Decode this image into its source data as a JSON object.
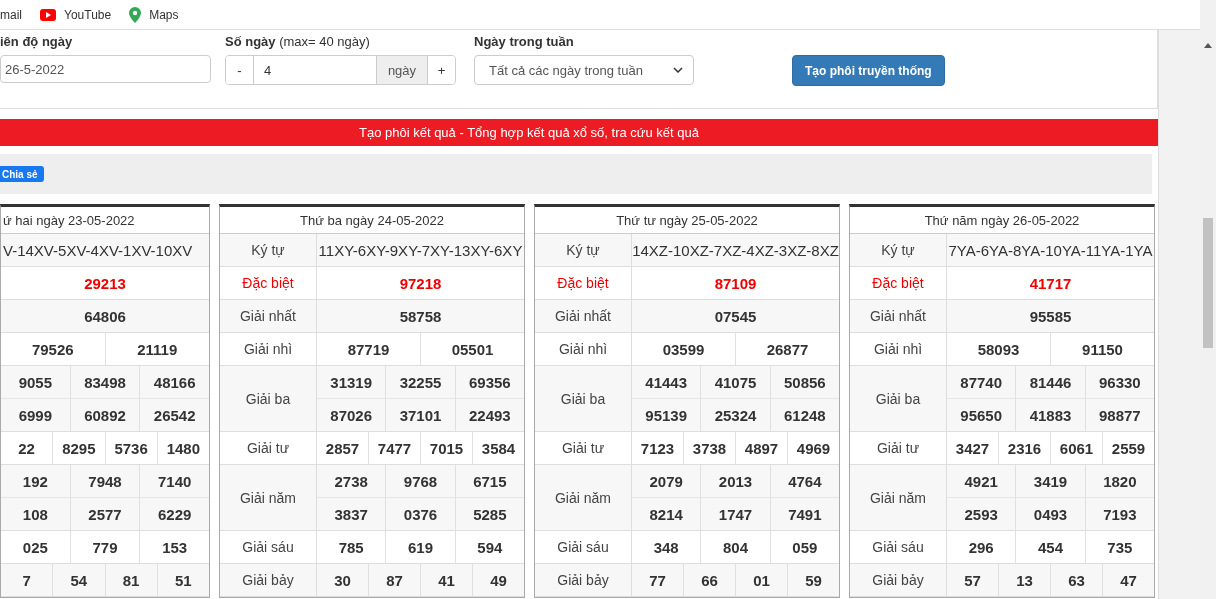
{
  "bookmarks": [
    {
      "label": "mail",
      "kind": "plain"
    },
    {
      "label": "YouTube",
      "kind": "youtube"
    },
    {
      "label": "Maps",
      "kind": "maps"
    }
  ],
  "form": {
    "date": {
      "label": "iên độ ngày",
      "value": "26-5-2022"
    },
    "days": {
      "label": "Số ngày",
      "hint": "(max= 40 ngày)",
      "minus": "-",
      "value": "4",
      "unit": "ngày",
      "plus": "+"
    },
    "weekday": {
      "label": "Ngày trong tuần",
      "value": "Tất cả các ngày trong tuần"
    },
    "button": "Tạo phôi truyền thống"
  },
  "banner": "Tạo phôi kết quả - Tổng hợp kết quả xổ số, tra cứu kết quả",
  "share_button": "Chia sẻ",
  "tables": [
    {
      "title": "ứ hai ngày 23-05-2022",
      "rows": [
        {
          "kind": "code",
          "lines": [
            [
              "V-14XV-5XV-4XV-1XV-10XV"
            ]
          ]
        },
        {
          "kind": "special",
          "lines": [
            [
              "29213"
            ]
          ]
        },
        {
          "kind": "prize",
          "lines": [
            [
              "64806"
            ]
          ]
        },
        {
          "kind": "prize",
          "lines": [
            [
              "79526",
              "21119"
            ]
          ]
        },
        {
          "kind": "prize",
          "lines": [
            [
              "9055",
              "83498",
              "48166"
            ],
            [
              "6999",
              "60892",
              "26542"
            ]
          ]
        },
        {
          "kind": "prize",
          "lines": [
            [
              "22",
              "8295",
              "5736",
              "1480"
            ]
          ]
        },
        {
          "kind": "prize",
          "lines": [
            [
              "192",
              "7948",
              "7140"
            ],
            [
              "108",
              "2577",
              "6229"
            ]
          ]
        },
        {
          "kind": "prize",
          "lines": [
            [
              "025",
              "779",
              "153"
            ]
          ]
        },
        {
          "kind": "prize",
          "lines": [
            [
              "7",
              "54",
              "81",
              "51"
            ]
          ]
        }
      ]
    },
    {
      "title": "Thứ ba ngày 24-05-2022",
      "rows": [
        {
          "label": "Ký tự",
          "kind": "code",
          "lines": [
            [
              "11XY-6XY-9XY-7XY-13XY-6XY"
            ]
          ]
        },
        {
          "label": "Đặc biệt",
          "kind": "special",
          "lines": [
            [
              "97218"
            ]
          ]
        },
        {
          "label": "Giải nhất",
          "kind": "prize",
          "lines": [
            [
              "58758"
            ]
          ]
        },
        {
          "label": "Giải nhì",
          "kind": "prize",
          "lines": [
            [
              "87719",
              "05501"
            ]
          ]
        },
        {
          "label": "Giải ba",
          "kind": "prize",
          "lines": [
            [
              "31319",
              "32255",
              "69356"
            ],
            [
              "87026",
              "37101",
              "22493"
            ]
          ]
        },
        {
          "label": "Giải tư",
          "kind": "prize",
          "lines": [
            [
              "2857",
              "7477",
              "7015",
              "3584"
            ]
          ]
        },
        {
          "label": "Giải năm",
          "kind": "prize",
          "lines": [
            [
              "2738",
              "9768",
              "6715"
            ],
            [
              "3837",
              "0376",
              "5285"
            ]
          ]
        },
        {
          "label": "Giải sáu",
          "kind": "prize",
          "lines": [
            [
              "785",
              "619",
              "594"
            ]
          ]
        },
        {
          "label": "Giải bảy",
          "kind": "prize",
          "lines": [
            [
              "30",
              "87",
              "41",
              "49"
            ]
          ]
        }
      ]
    },
    {
      "title": "Thứ tư ngày 25-05-2022",
      "rows": [
        {
          "label": "Ký tự",
          "kind": "code",
          "lines": [
            [
              "14XZ-10XZ-7XZ-4XZ-3XZ-8XZ"
            ]
          ]
        },
        {
          "label": "Đặc biệt",
          "kind": "special",
          "lines": [
            [
              "87109"
            ]
          ]
        },
        {
          "label": "Giải nhất",
          "kind": "prize",
          "lines": [
            [
              "07545"
            ]
          ]
        },
        {
          "label": "Giải nhì",
          "kind": "prize",
          "lines": [
            [
              "03599",
              "26877"
            ]
          ]
        },
        {
          "label": "Giải ba",
          "kind": "prize",
          "lines": [
            [
              "41443",
              "41075",
              "50856"
            ],
            [
              "95139",
              "25324",
              "61248"
            ]
          ]
        },
        {
          "label": "Giải tư",
          "kind": "prize",
          "lines": [
            [
              "7123",
              "3738",
              "4897",
              "4969"
            ]
          ]
        },
        {
          "label": "Giải năm",
          "kind": "prize",
          "lines": [
            [
              "2079",
              "2013",
              "4764"
            ],
            [
              "8214",
              "1747",
              "7491"
            ]
          ]
        },
        {
          "label": "Giải sáu",
          "kind": "prize",
          "lines": [
            [
              "348",
              "804",
              "059"
            ]
          ]
        },
        {
          "label": "Giải bảy",
          "kind": "prize",
          "lines": [
            [
              "77",
              "66",
              "01",
              "59"
            ]
          ]
        }
      ]
    },
    {
      "title": "Thứ năm ngày 26-05-2022",
      "rows": [
        {
          "label": "Ký tự",
          "kind": "code",
          "lines": [
            [
              "7YA-6YA-8YA-10YA-11YA-1YA"
            ]
          ]
        },
        {
          "label": "Đặc biệt",
          "kind": "special",
          "lines": [
            [
              "41717"
            ]
          ]
        },
        {
          "label": "Giải nhất",
          "kind": "prize",
          "lines": [
            [
              "95585"
            ]
          ]
        },
        {
          "label": "Giải nhì",
          "kind": "prize",
          "lines": [
            [
              "58093",
              "91150"
            ]
          ]
        },
        {
          "label": "Giải ba",
          "kind": "prize",
          "lines": [
            [
              "87740",
              "81446",
              "96330"
            ],
            [
              "95650",
              "41883",
              "98877"
            ]
          ]
        },
        {
          "label": "Giải tư",
          "kind": "prize",
          "lines": [
            [
              "3427",
              "2316",
              "6061",
              "2559"
            ]
          ]
        },
        {
          "label": "Giải năm",
          "kind": "prize",
          "lines": [
            [
              "4921",
              "3419",
              "1820"
            ],
            [
              "2593",
              "0493",
              "7193"
            ]
          ]
        },
        {
          "label": "Giải sáu",
          "kind": "prize",
          "lines": [
            [
              "296",
              "454",
              "735"
            ]
          ]
        },
        {
          "label": "Giải bảy",
          "kind": "prize",
          "lines": [
            [
              "57",
              "13",
              "63",
              "47"
            ]
          ]
        }
      ]
    }
  ]
}
